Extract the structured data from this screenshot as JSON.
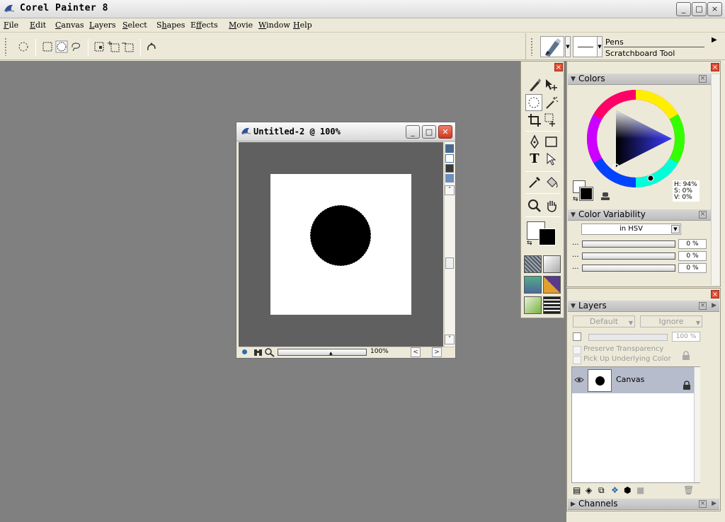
{
  "app": {
    "title": "Corel Painter 8",
    "window_controls": [
      "_",
      "□",
      "×"
    ]
  },
  "menu": [
    "File",
    "Edit",
    "Canvas",
    "Layers",
    "Select",
    "Shapes",
    "Effects",
    "Movie",
    "Window",
    "Help"
  ],
  "menu_underlines": [
    "F",
    "E",
    "C",
    "L",
    "S",
    "h",
    "f",
    "M",
    "W",
    "H"
  ],
  "brush": {
    "category": "Pens",
    "variant": "Scratchboard Tool"
  },
  "document": {
    "title": "Untitled-2 @ 100%",
    "zoom": "100%"
  },
  "colors_palette": {
    "title": "Colors",
    "h": "H: 94%",
    "s": "S: 0%",
    "v": "V: 0%"
  },
  "color_variability": {
    "title": "Color Variability",
    "mode": "in HSV",
    "rows": [
      {
        "dots": "...",
        "value": "0 %"
      },
      {
        "dots": "...",
        "value": "0 %"
      },
      {
        "dots": "...",
        "value": "0 %"
      }
    ]
  },
  "layers": {
    "title": "Layers",
    "composite_method": "Default",
    "composite_depth": "Ignore",
    "opacity": "100 %",
    "preserve_transparency": "Preserve Transparency",
    "pick_up_color": "Pick Up Underlying Color",
    "items": [
      {
        "name": "Canvas"
      }
    ]
  },
  "channels": {
    "title": "Channels"
  },
  "colors": {
    "workspace": "#808080",
    "close_red": "#e04a2f"
  }
}
